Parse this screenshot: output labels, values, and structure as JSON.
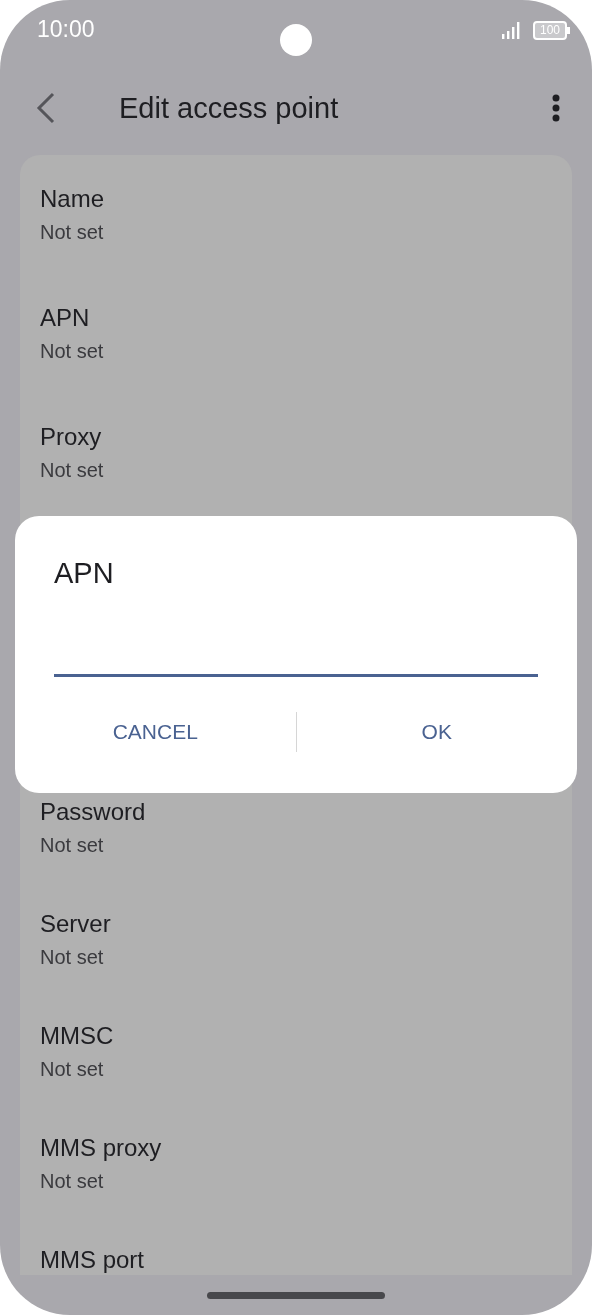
{
  "status_bar": {
    "time": "10:00",
    "battery": "100"
  },
  "header": {
    "title": "Edit access point"
  },
  "settings_above": [
    {
      "title": "Name",
      "value": "Not set"
    },
    {
      "title": "APN",
      "value": "Not set"
    },
    {
      "title": "Proxy",
      "value": "Not set"
    }
  ],
  "settings_below": [
    {
      "title": "Password",
      "value": "Not set"
    },
    {
      "title": "Server",
      "value": "Not set"
    },
    {
      "title": "MMSC",
      "value": "Not set"
    },
    {
      "title": "MMS proxy",
      "value": "Not set"
    },
    {
      "title": "MMS port"
    }
  ],
  "dialog": {
    "title": "APN",
    "buttons": [
      "CANCEL",
      "OK"
    ]
  }
}
